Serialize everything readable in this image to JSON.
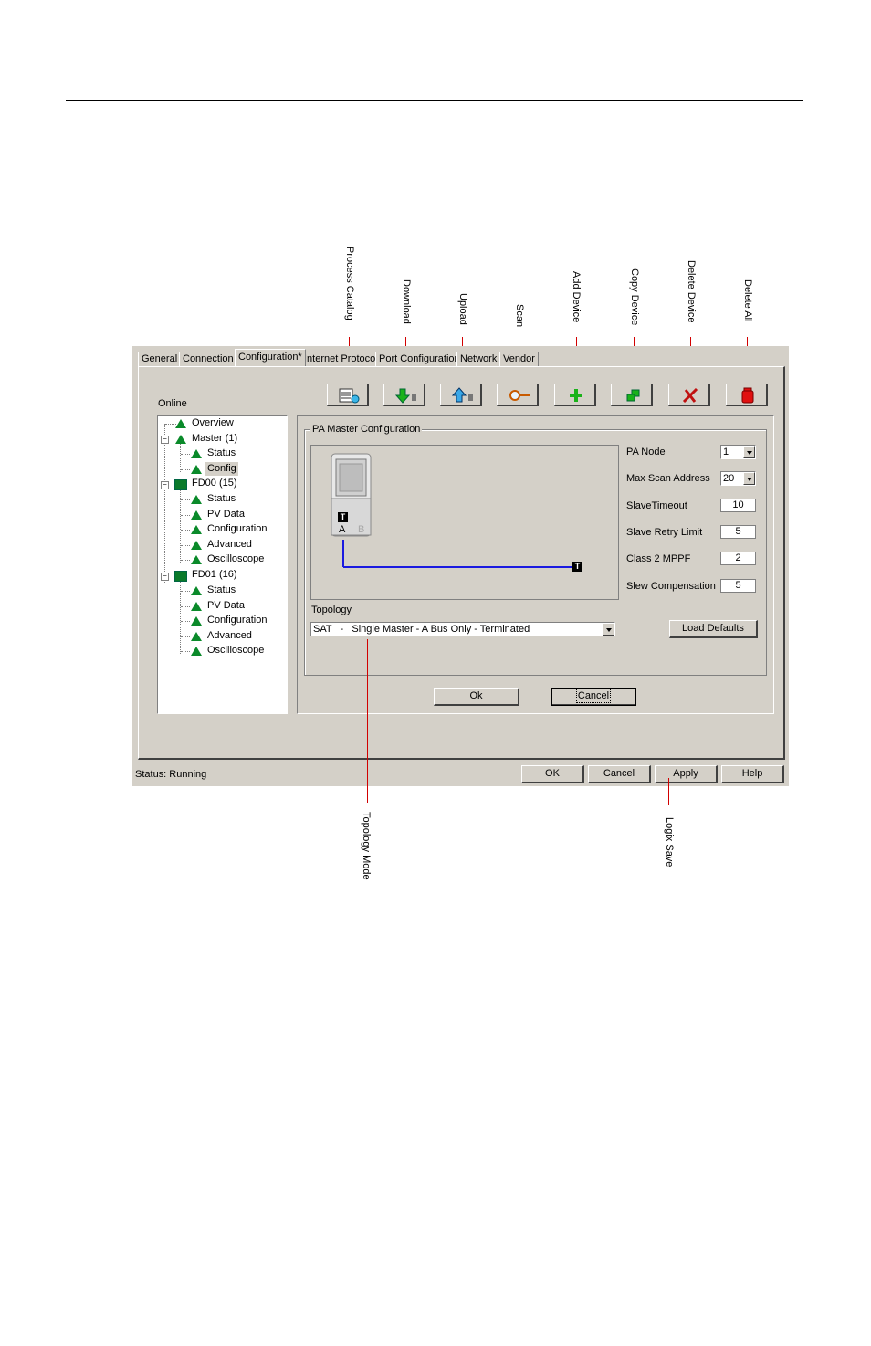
{
  "callouts": {
    "process_catalog": "Process Catalog",
    "download": "Download",
    "upload": "Upload",
    "scan": "Scan",
    "add_device": "Add Device",
    "copy_device": "Copy Device",
    "delete_device": "Delete Device",
    "delete_all": "Delete All",
    "topology_mode": "Topology Mode",
    "logix_save": "Logix Save"
  },
  "tabs": [
    "General",
    "Connection",
    "Configuration*",
    "Internet Protocol",
    "Port Configuration",
    "Network",
    "Vendor"
  ],
  "online_label": "Online",
  "tree": {
    "overview": "Overview",
    "master": "Master (1)",
    "master_status": "Status",
    "master_config": "Config",
    "fd00": "FD00 (15)",
    "fd00_items": [
      "Status",
      "PV Data",
      "Configuration",
      "Advanced",
      "Oscilloscope"
    ],
    "fd01": "FD01 (16)",
    "fd01_items": [
      "Status",
      "PV Data",
      "Configuration",
      "Advanced",
      "Oscilloscope"
    ]
  },
  "group_title": "PA Master Configuration",
  "diagram": {
    "t_label": "T",
    "port_a": "A",
    "port_b": "B",
    "end_t": "T"
  },
  "fields": {
    "pa_node_label": "PA Node",
    "pa_node_value": "1",
    "max_scan_label": "Max Scan Address",
    "max_scan_value": "20",
    "slave_timeout_label": "SlaveTimeout",
    "slave_timeout_value": "10",
    "slave_retry_label": "Slave Retry Limit",
    "slave_retry_value": "5",
    "class2_label": "Class 2 MPPF",
    "class2_value": "2",
    "slew_label": "Slew Compensation",
    "slew_value": "5"
  },
  "topology_label": "Topology",
  "topology_value": "SAT   -   Single Master - A Bus Only - Terminated",
  "load_defaults": "Load Defaults",
  "inner_ok": "Ok",
  "inner_cancel": "Cancel",
  "status_text": "Status:  Running",
  "bottom_buttons": {
    "ok": "OK",
    "cancel": "Cancel",
    "apply": "Apply",
    "help": "Help"
  },
  "colors": {
    "dialog_bg": "#d4d0c8",
    "callout_line": "#d20000",
    "tree_icon": "#0a8a2a",
    "bus_line": "#1a1ae0"
  }
}
